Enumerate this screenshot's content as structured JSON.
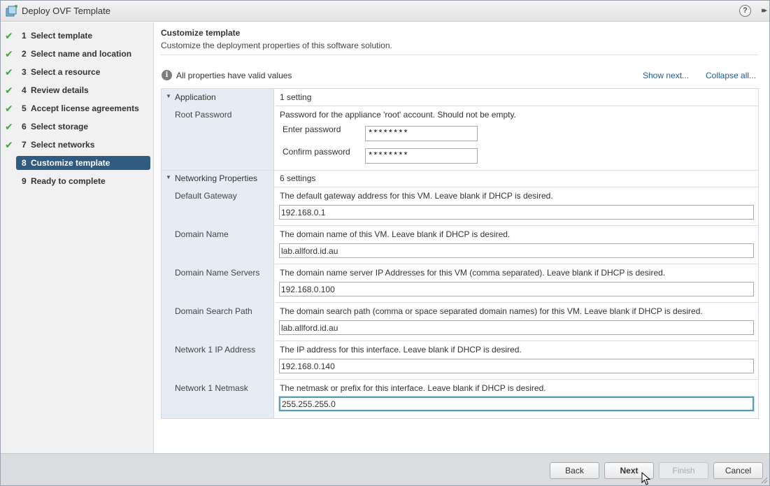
{
  "window": {
    "title": "Deploy OVF Template",
    "help_glyph": "?",
    "expand_glyph": "▸▸"
  },
  "steps": [
    {
      "num": "1",
      "label": "Select template",
      "completed": true
    },
    {
      "num": "2",
      "label": "Select name and location",
      "completed": true
    },
    {
      "num": "3",
      "label": "Select a resource",
      "completed": true
    },
    {
      "num": "4",
      "label": "Review details",
      "completed": true
    },
    {
      "num": "5",
      "label": "Accept license agreements",
      "completed": true
    },
    {
      "num": "6",
      "label": "Select storage",
      "completed": true
    },
    {
      "num": "7",
      "label": "Select networks",
      "completed": true
    },
    {
      "num": "8",
      "label": "Customize template",
      "completed": false,
      "active": true
    },
    {
      "num": "9",
      "label": "Ready to complete",
      "completed": false
    }
  ],
  "page": {
    "title": "Customize template",
    "subtitle": "Customize the deployment properties of this software solution.",
    "status": "All properties have valid values",
    "show_next": "Show next...",
    "collapse_all": "Collapse all..."
  },
  "application": {
    "name": "Application",
    "count": "1 setting",
    "root_password": {
      "label": "Root Password",
      "description": "Password for the appliance 'root' account. Should not be empty.",
      "enter_label": "Enter password",
      "enter_value": "********",
      "confirm_label": "Confirm password",
      "confirm_value": "********"
    }
  },
  "networking": {
    "name": "Networking Properties",
    "count": "6 settings",
    "properties": [
      {
        "label": "Default Gateway",
        "description": "The default gateway address for this VM. Leave blank if DHCP is desired.",
        "value": "192.168.0.1"
      },
      {
        "label": "Domain Name",
        "description": "The domain name of this VM. Leave blank if DHCP is desired.",
        "value": "lab.allford.id.au"
      },
      {
        "label": "Domain Name Servers",
        "description": "The domain name server IP Addresses for this VM (comma separated). Leave blank if DHCP is desired.",
        "value": "192.168.0.100"
      },
      {
        "label": "Domain Search Path",
        "description": "The domain search path (comma or space separated domain names) for this VM. Leave blank if DHCP is desired.",
        "value": "lab.allford.id.au"
      },
      {
        "label": "Network 1 IP Address",
        "description": "The IP address for this interface. Leave blank if DHCP is desired.",
        "value": "192.168.0.140"
      },
      {
        "label": "Network 1 Netmask",
        "description": "The netmask or prefix for this interface. Leave blank if DHCP is desired.",
        "value": "255.255.255.0"
      }
    ]
  },
  "footer": {
    "back": "Back",
    "next": "Next",
    "finish": "Finish",
    "cancel": "Cancel"
  },
  "colors": {
    "active_step_bg": "#305a80",
    "check_green": "#3fa83a",
    "link_blue": "#1d5a9c",
    "label_column_bg": "#e5ecf3"
  }
}
